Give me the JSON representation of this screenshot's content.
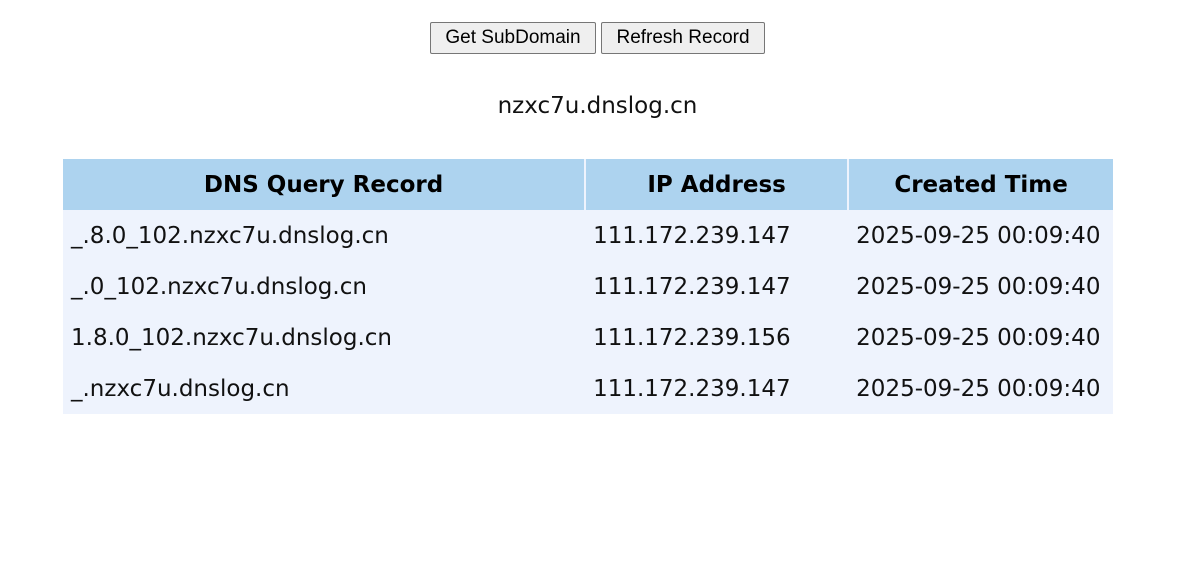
{
  "buttons": {
    "get_subdomain_label": "Get SubDomain",
    "refresh_record_label": "Refresh Record"
  },
  "subdomain": "nzxc7u.dnslog.cn",
  "table": {
    "headers": [
      "DNS Query Record",
      "IP Address",
      "Created Time"
    ],
    "rows": [
      [
        "_.8.0_102.nzxc7u.dnslog.cn",
        "111.172.239.147",
        "2025-09-25 00:09:40"
      ],
      [
        "_.0_102.nzxc7u.dnslog.cn",
        "111.172.239.147",
        "2025-09-25 00:09:40"
      ],
      [
        "1.8.0_102.nzxc7u.dnslog.cn",
        "111.172.239.156",
        "2025-09-25 00:09:40"
      ],
      [
        "_.nzxc7u.dnslog.cn",
        "111.172.239.147",
        "2025-09-25 00:09:40"
      ]
    ]
  },
  "colors": {
    "header_bg": "#add3ef",
    "row_bg": "#eef3fd"
  }
}
